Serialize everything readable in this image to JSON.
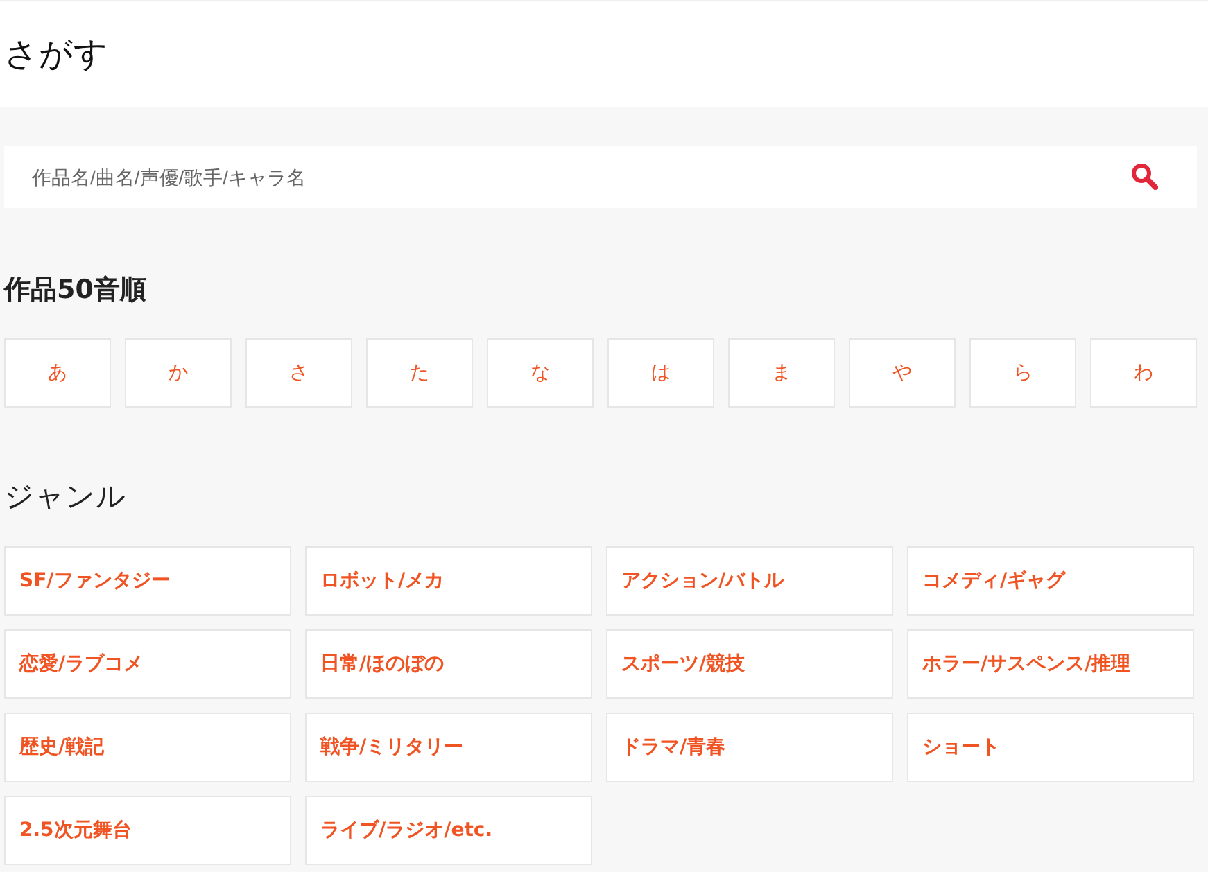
{
  "title": "さがす",
  "search": {
    "placeholder": "作品名/曲名/声優/歌手/キャラ名"
  },
  "kana_section": {
    "heading": "作品50音順",
    "items": [
      "あ",
      "か",
      "さ",
      "た",
      "な",
      "は",
      "ま",
      "や",
      "ら",
      "わ"
    ]
  },
  "genre_section": {
    "heading": "ジャンル",
    "items": [
      "SF/ファンタジー",
      "ロボット/メカ",
      "アクション/バトル",
      "コメディ/ギャグ",
      "恋愛/ラブコメ",
      "日常/ほのぼの",
      "スポーツ/競技",
      "ホラー/サスペンス/推理",
      "歴史/戦記",
      "戦争/ミリタリー",
      "ドラマ/青春",
      "ショート",
      "2.5次元舞台",
      "ライブ/ラジオ/etc."
    ]
  }
}
